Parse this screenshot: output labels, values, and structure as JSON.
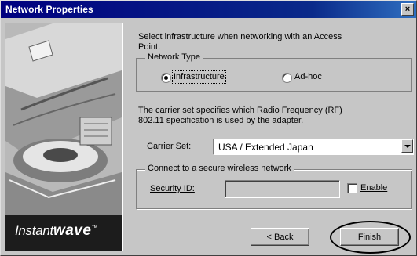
{
  "window": {
    "title": "Network Properties",
    "close_glyph": "×"
  },
  "branding": {
    "logo_prefix": "Instant",
    "logo_suffix": "wave",
    "logo_mark": "™"
  },
  "intro": {
    "line1": "Select infrastructure when networking with an Access",
    "line2": "Point."
  },
  "network_type": {
    "legend": "Network Type",
    "options": [
      {
        "label": "Infrastructure",
        "selected": true
      },
      {
        "label": "Ad-hoc",
        "selected": false
      }
    ]
  },
  "carrier_info": {
    "line1": "The carrier set specifies which Radio Frequency (RF)",
    "line2": "802.11 specification is used by the adapter."
  },
  "carrier_set": {
    "label": "Carrier Set:",
    "value": "USA / Extended Japan"
  },
  "secure": {
    "legend": "Connect to a secure wireless network",
    "security_id_label": "Security ID:",
    "security_id_value": "",
    "enable_label": "Enable",
    "enable_checked": false
  },
  "buttons": {
    "back": "< Back",
    "finish": "Finish"
  },
  "colors": {
    "titlebar": "#00007f",
    "face": "#c6c6c6",
    "annotation": "#000000"
  }
}
